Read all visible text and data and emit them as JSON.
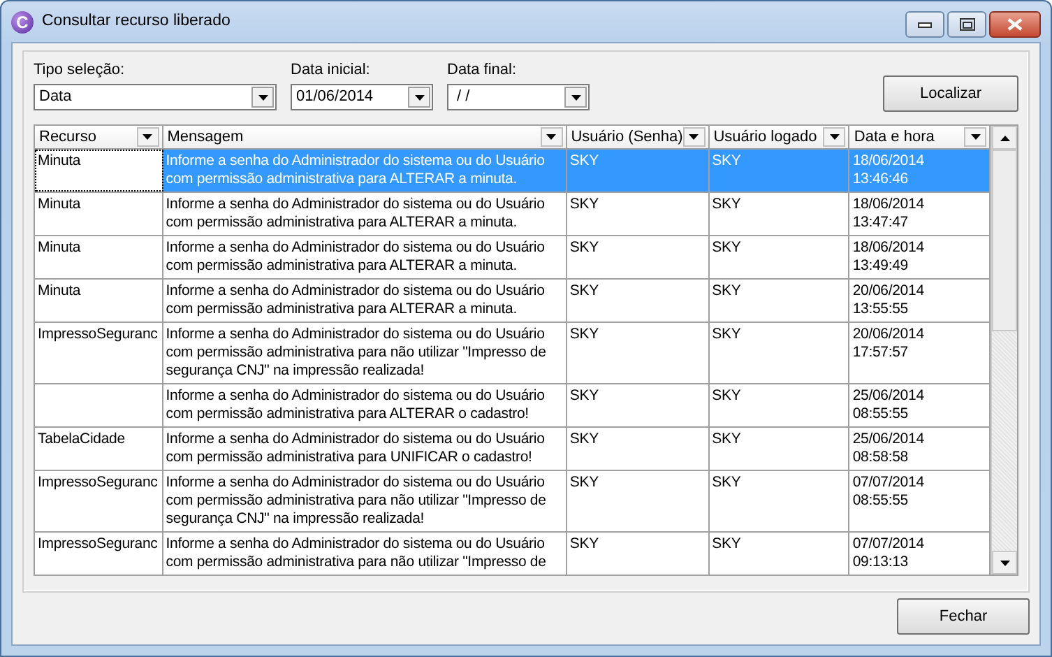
{
  "window": {
    "title": "Consultar recurso liberado",
    "icon_text": "C"
  },
  "filters": [
    {
      "label": "Tipo seleção:",
      "value": "Data",
      "kind": "wide"
    },
    {
      "label": "Data inicial:",
      "value": "01/06/2014",
      "kind": "date"
    },
    {
      "label": "Data final:",
      "value": " / /",
      "kind": "date"
    }
  ],
  "search_button": {
    "label": "Localizar"
  },
  "table": {
    "columns": [
      "Recurso",
      "Mensagem",
      "Usuário (Senha)",
      "Usuário logado",
      "Data e hora"
    ],
    "rows": [
      {
        "selected": true,
        "resource": "Minuta",
        "message": "Informe a senha do Administrador do sistema ou do Usuário\ncom permissão administrativa para ALTERAR a minuta.",
        "user_password": "SKY",
        "user_logged": "SKY",
        "date_time": "18/06/2014\n13:46:46"
      },
      {
        "selected": false,
        "resource": "Minuta",
        "message": "Informe a senha do Administrador do sistema ou do Usuário\ncom permissão administrativa para ALTERAR a minuta.",
        "user_password": "SKY",
        "user_logged": "SKY",
        "date_time": "18/06/2014\n13:47:47"
      },
      {
        "selected": false,
        "resource": "Minuta",
        "message": "Informe a senha do Administrador do sistema ou do Usuário\ncom permissão administrativa para ALTERAR a minuta.",
        "user_password": "SKY",
        "user_logged": "SKY",
        "date_time": "18/06/2014\n13:49:49"
      },
      {
        "selected": false,
        "resource": "Minuta",
        "message": "Informe a senha do Administrador do sistema ou do Usuário\ncom permissão administrativa para ALTERAR a minuta.",
        "user_password": "SKY",
        "user_logged": "SKY",
        "date_time": "20/06/2014\n13:55:55"
      },
      {
        "selected": false,
        "resource": "ImpressoSeguranc",
        "message": "Informe a senha do Administrador do sistema ou do Usuário\ncom permissão administrativa para não utilizar \"Impresso de\nsegurança CNJ\" na impressão realizada!",
        "user_password": "SKY",
        "user_logged": "SKY",
        "date_time": "20/06/2014\n17:57:57"
      },
      {
        "selected": false,
        "message": "Informe a senha do Administrador do sistema ou do Usuário\ncom permissão administrativa para ALTERAR o cadastro!",
        "user_password": "SKY",
        "user_logged": "SKY",
        "date_time": "25/06/2014\n08:55:55"
      },
      {
        "selected": false,
        "resource": "TabelaCidade",
        "message": "Informe a senha do Administrador do sistema ou do Usuário\ncom permissão administrativa para UNIFICAR o cadastro!",
        "user_password": "SKY",
        "user_logged": "SKY",
        "date_time": "25/06/2014\n08:58:58"
      },
      {
        "selected": false,
        "resource": "ImpressoSeguranc",
        "message": "Informe a senha do Administrador do sistema ou do Usuário\ncom permissão administrativa para não utilizar \"Impresso de\nsegurança CNJ\" na impressão realizada!",
        "user_password": "SKY",
        "user_logged": "SKY",
        "date_time": "07/07/2014\n08:55:55"
      },
      {
        "selected": false,
        "resource": "ImpressoSeguranc",
        "message": "Informe a senha do Administrador do sistema ou do Usuário\ncom permissão administrativa para não utilizar \"Impresso de",
        "user_password": "SKY",
        "user_logged": "SKY",
        "date_time": "07/07/2014\n09:13:13"
      }
    ]
  },
  "close_button": {
    "label": "Fechar"
  }
}
